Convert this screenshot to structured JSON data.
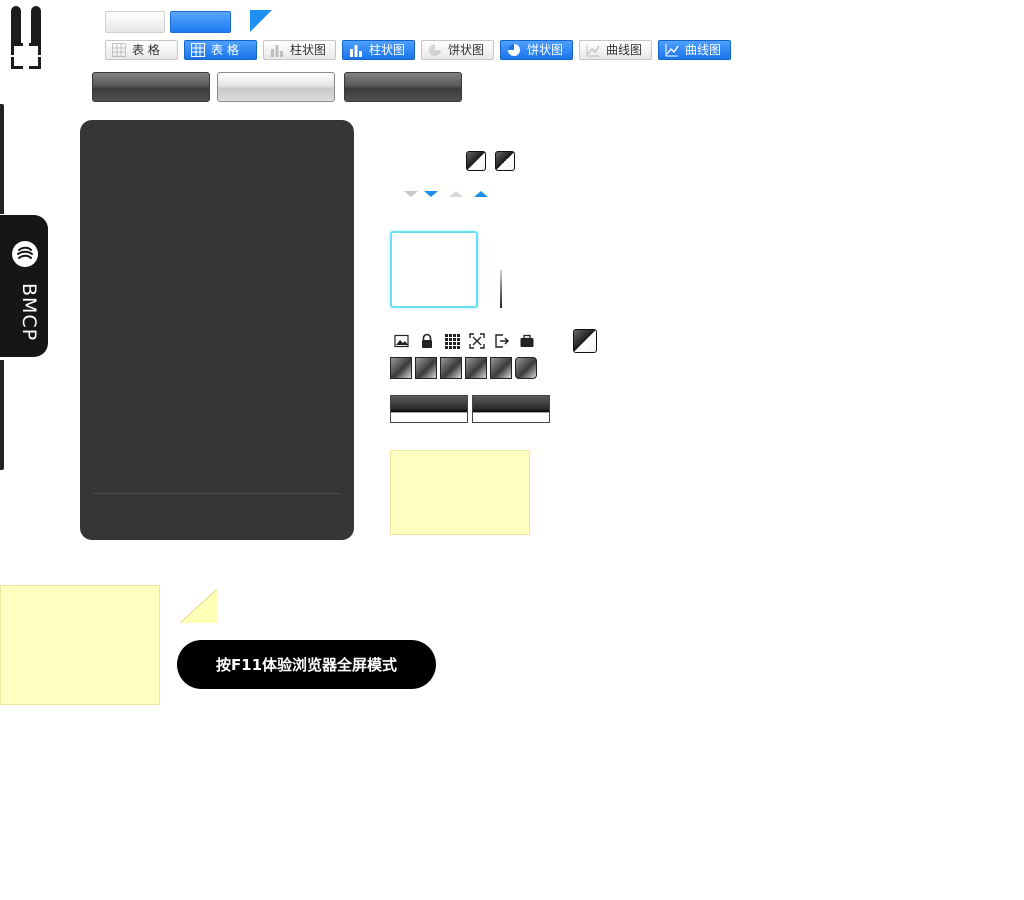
{
  "toggles": [
    {
      "label": "表 格",
      "icon": "table-icon",
      "active": false
    },
    {
      "label": "表 格",
      "icon": "table-icon",
      "active": true
    },
    {
      "label": "柱状图",
      "icon": "bar-chart-icon",
      "active": false
    },
    {
      "label": "柱状图",
      "icon": "bar-chart-icon",
      "active": true
    },
    {
      "label": "饼状图",
      "icon": "pie-chart-icon",
      "active": false
    },
    {
      "label": "饼状图",
      "icon": "pie-chart-icon",
      "active": true
    },
    {
      "label": "曲线图",
      "icon": "line-chart-icon",
      "active": false
    },
    {
      "label": "曲线图",
      "icon": "line-chart-icon",
      "active": true
    }
  ],
  "side_tab": {
    "label": "BMCP",
    "icon": "brand-logo-icon"
  },
  "toolbar_icons": [
    "image-icon",
    "lock-icon",
    "grid-icon",
    "fullscreen-icon",
    "export-icon",
    "briefcase-icon"
  ],
  "fullscreen_hint": {
    "label": "按F11体验浏览器全屏模式"
  },
  "colors": {
    "accent_blue": "#1d7af0",
    "panel_dark": "#363636",
    "note_yellow": "#ffffc0",
    "highlight_cyan": "#6ae0f6"
  }
}
